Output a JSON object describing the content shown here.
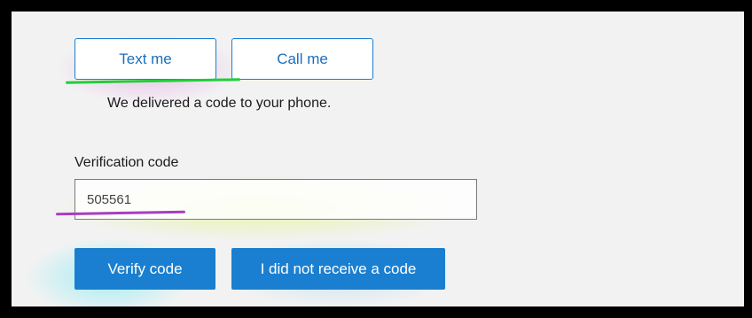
{
  "options": {
    "text_me_label": "Text me",
    "call_me_label": "Call me"
  },
  "status_message": "We delivered a code to your phone.",
  "verification": {
    "label": "Verification code",
    "value": "505561"
  },
  "actions": {
    "verify_label": "Verify code",
    "no_code_label": "I did not receive a code"
  },
  "colors": {
    "accent": "#1a7fd0",
    "highlight_green": "#1fcf3a",
    "highlight_purple": "#a83dc0"
  }
}
